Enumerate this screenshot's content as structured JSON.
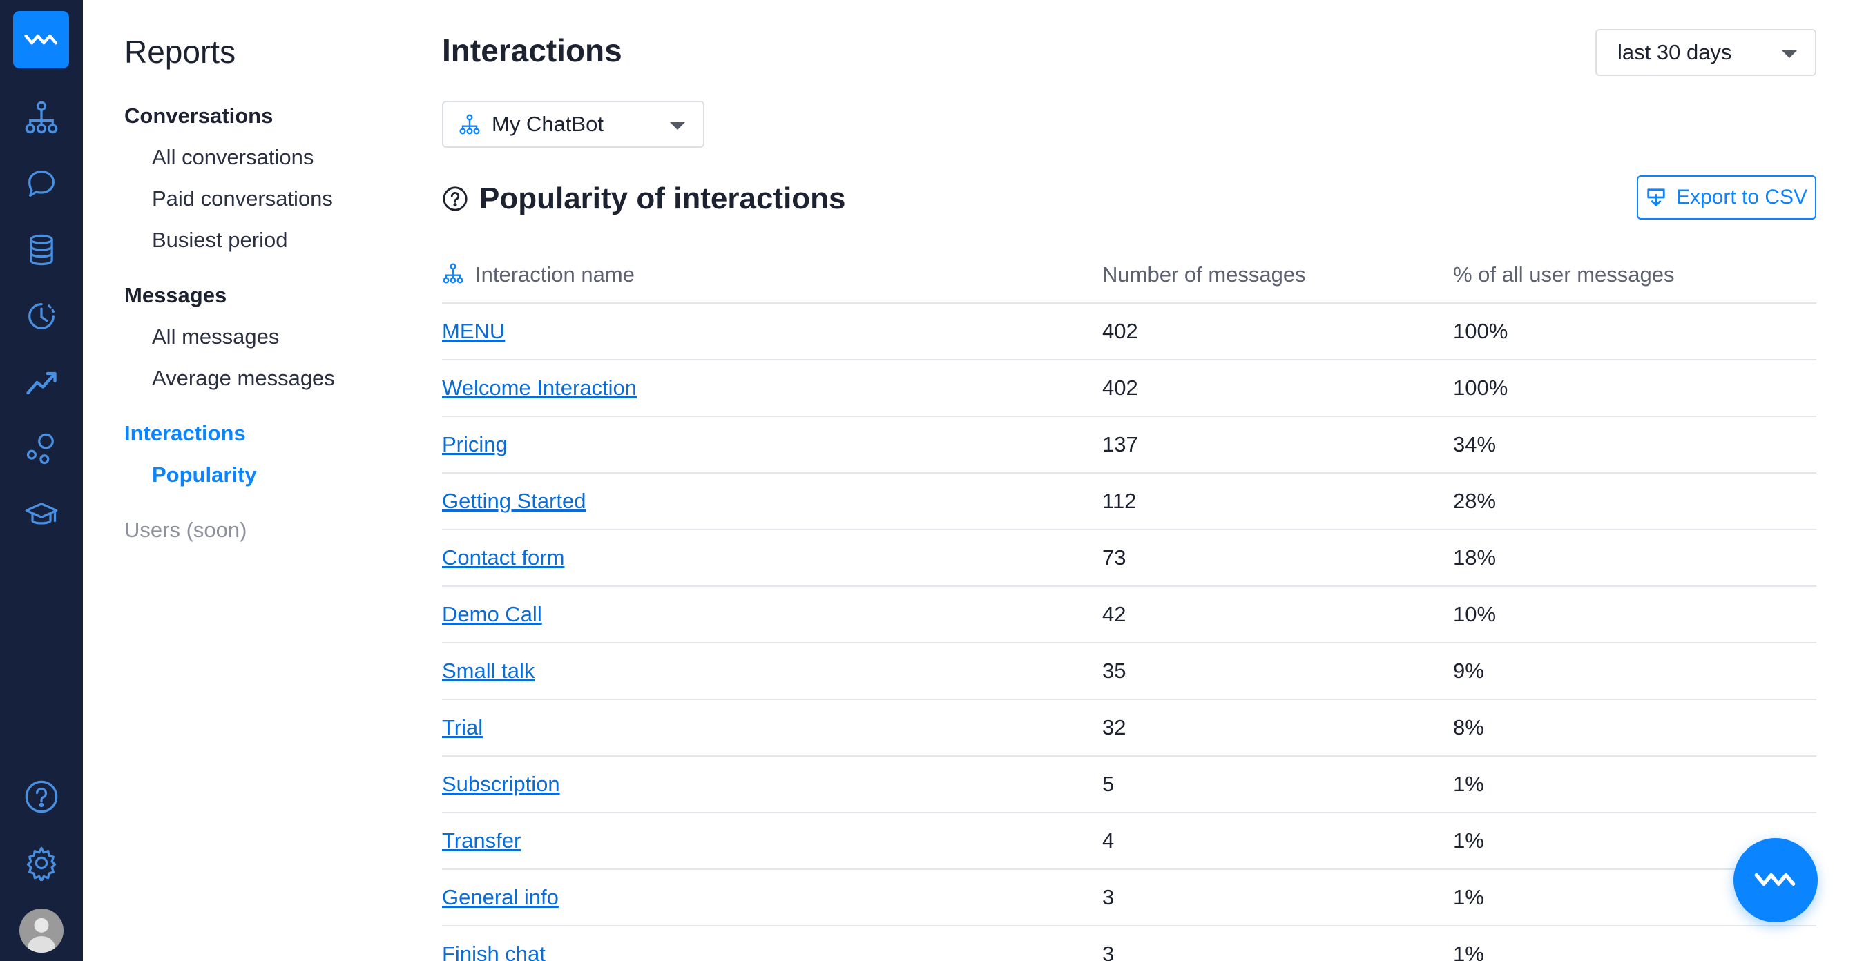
{
  "rail": {
    "icons": [
      "logo-wave-icon",
      "bot-tree-icon",
      "chat-bubble-icon",
      "database-icon",
      "history-clock-icon",
      "reports-trend-icon",
      "integrations-icon",
      "academy-cap-icon",
      "help-icon",
      "settings-gear-icon"
    ]
  },
  "subnav": {
    "title": "Reports",
    "groups": [
      {
        "label": "Conversations",
        "items": [
          "All conversations",
          "Paid conversations",
          "Busiest period"
        ]
      },
      {
        "label": "Messages",
        "items": [
          "All messages",
          "Average messages"
        ]
      },
      {
        "label": "Interactions",
        "items": [
          "Popularity"
        ]
      }
    ],
    "users_soon": "Users (soon)"
  },
  "main": {
    "title": "Interactions",
    "period": "last 30 days",
    "bot": "My ChatBot",
    "section_title": "Popularity of interactions",
    "export_label": "Export to CSV",
    "table": {
      "headers": [
        "Interaction name",
        "Number of messages",
        "% of all user messages"
      ],
      "rows": [
        {
          "name": "MENU",
          "count": "402",
          "pct": "100%"
        },
        {
          "name": "Welcome Interaction",
          "count": "402",
          "pct": "100%"
        },
        {
          "name": "Pricing",
          "count": "137",
          "pct": "34%"
        },
        {
          "name": "Getting Started",
          "count": "112",
          "pct": "28%"
        },
        {
          "name": "Contact form",
          "count": "73",
          "pct": "18%"
        },
        {
          "name": "Demo Call",
          "count": "42",
          "pct": "10%"
        },
        {
          "name": "Small talk",
          "count": "35",
          "pct": "9%"
        },
        {
          "name": "Trial",
          "count": "32",
          "pct": "8%"
        },
        {
          "name": "Subscription",
          "count": "5",
          "pct": "1%"
        },
        {
          "name": "Transfer",
          "count": "4",
          "pct": "1%"
        },
        {
          "name": "General info",
          "count": "3",
          "pct": "1%"
        },
        {
          "name": "Finish chat",
          "count": "3",
          "pct": "1%"
        }
      ]
    }
  },
  "colors": {
    "rail_bg": "#16213d",
    "accent": "#0a84ff",
    "link": "#0a6cd6"
  }
}
